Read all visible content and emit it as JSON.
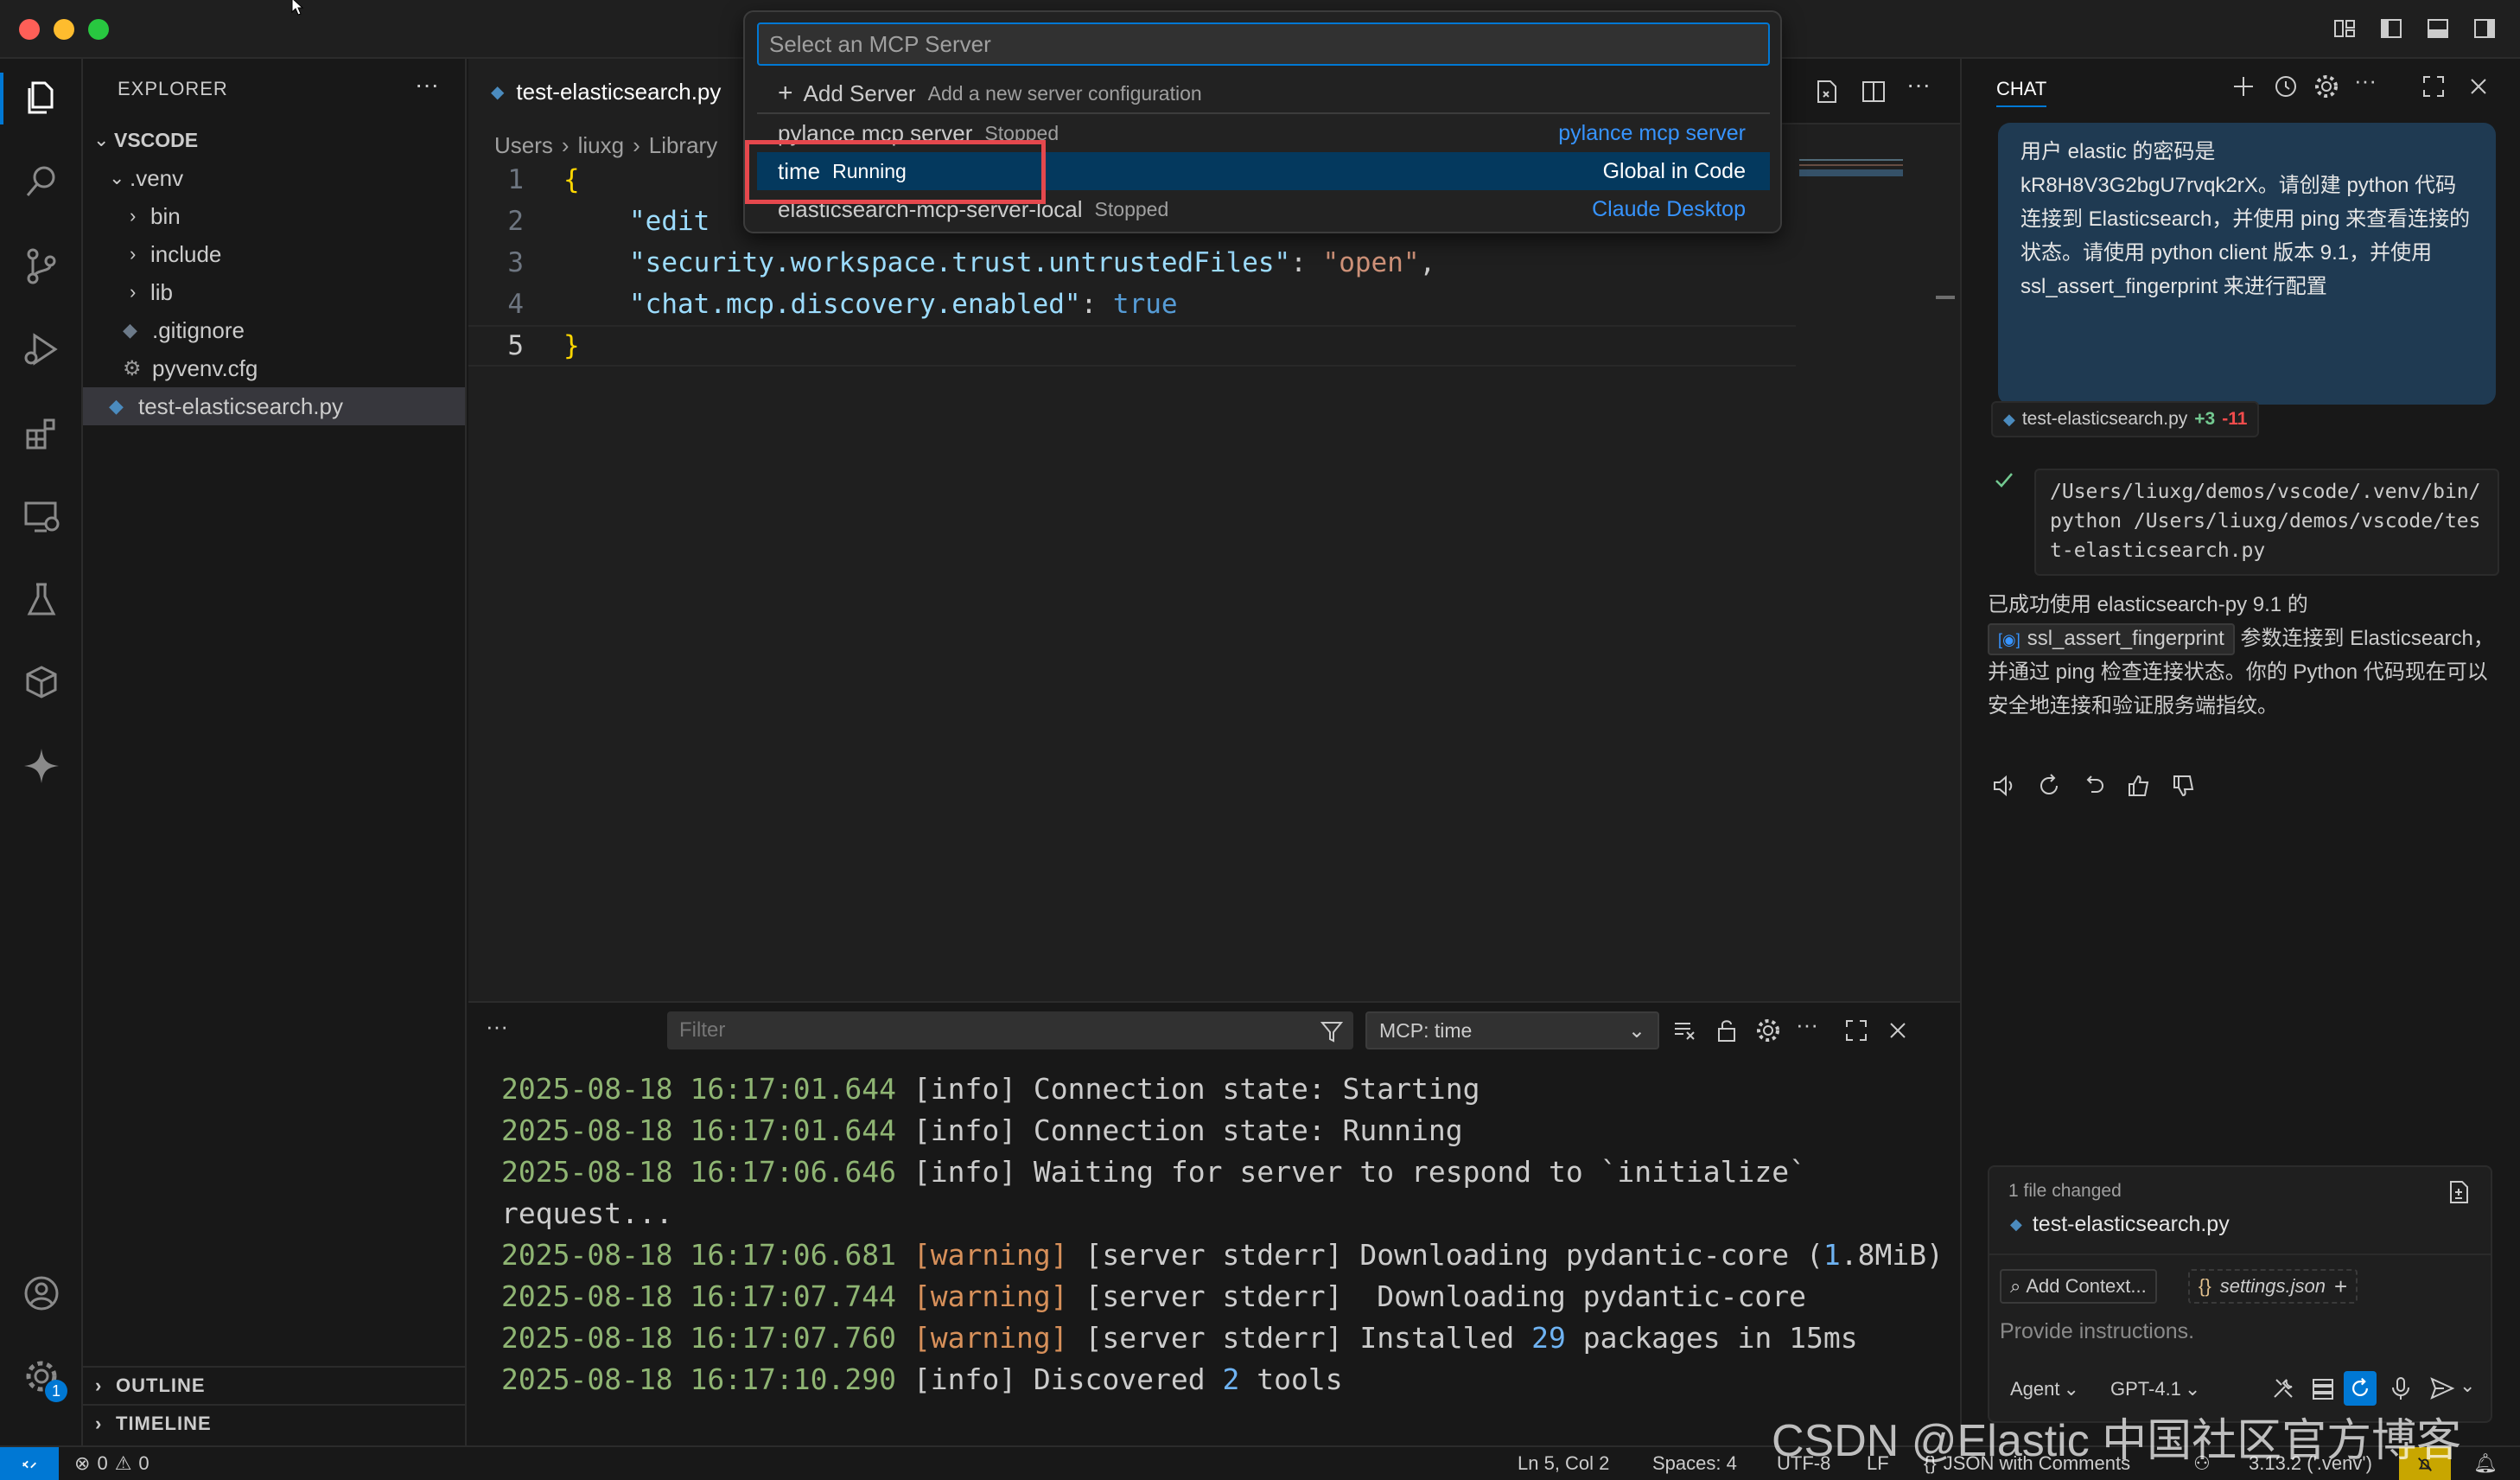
{
  "explorer": {
    "header": "EXPLORER",
    "root": "VSCODE",
    "items": [
      {
        "label": ".venv"
      },
      {
        "label": "bin"
      },
      {
        "label": "include"
      },
      {
        "label": "lib"
      },
      {
        "label": ".gitignore"
      },
      {
        "label": "pyvenv.cfg"
      },
      {
        "label": "test-elasticsearch.py"
      }
    ],
    "outline": "OUTLINE",
    "timeline": "TIMELINE"
  },
  "editor": {
    "tab_label": "test-elasticsearch.py",
    "breadcrumb": [
      "Users",
      "liuxg",
      "Library"
    ],
    "lines": [
      {
        "n": "1",
        "text": "{"
      },
      {
        "n": "2",
        "text": "\"edit"
      },
      {
        "n": "3",
        "key": "\"security.workspace.trust.untrustedFiles\"",
        "sep": ": ",
        "val": "\"open\"",
        "end": ","
      },
      {
        "n": "4",
        "key": "\"chat.mcp.discovery.enabled\"",
        "sep": ": ",
        "val": "true"
      },
      {
        "n": "5",
        "text": "}"
      }
    ]
  },
  "quickpick": {
    "placeholder": "Select an MCP Server",
    "add_label": "Add Server",
    "add_desc": "Add a new server configuration",
    "items": [
      {
        "label": "pylance mcp server",
        "status": "Stopped",
        "source": "pylance mcp server"
      },
      {
        "label": "time",
        "status": "Running",
        "source": "Global in Code"
      },
      {
        "label": "elasticsearch-mcp-server-local",
        "status": "Stopped",
        "source": "Claude Desktop"
      }
    ]
  },
  "panel": {
    "dots": "···",
    "filter_placeholder": "Filter",
    "channel": "MCP: time",
    "logs": [
      {
        "ts": "2025-08-18 16:17:01.644",
        "level": "[info]",
        "msg": " Connection state: Starting"
      },
      {
        "ts": "2025-08-18 16:17:01.644",
        "level": "[info]",
        "msg": " Connection state: Running"
      },
      {
        "ts": "2025-08-18 16:17:06.646",
        "level": "[info]",
        "msg": " Waiting for server to respond to `initialize`"
      },
      {
        "ts": "",
        "level": "",
        "msg": "request..."
      },
      {
        "ts": "2025-08-18 16:17:06.681",
        "level": "[warning]",
        "msg": " [server stderr] Downloading pydantic-core (",
        "num": "1",
        "tail": ".8MiB)"
      },
      {
        "ts": "2025-08-18 16:17:07.744",
        "level": "[warning]",
        "msg": " [server stderr]  Downloading pydantic-core"
      },
      {
        "ts": "2025-08-18 16:17:07.760",
        "level": "[warning]",
        "msg": " [server stderr] Installed ",
        "num": "29",
        "tail": " packages in 15ms"
      },
      {
        "ts": "2025-08-18 16:17:10.290",
        "level": "[info]",
        "msg": " Discovered ",
        "num": "2",
        "tail": " tools"
      }
    ]
  },
  "chat": {
    "title": "CHAT",
    "user_message": "用户 elastic 的密码是 kR8H8V3G2bgU7rvqk2rX。请创建 python 代码连接到 Elasticsearch，并使用 ping 来查看连接的状态。请使用 python client 版本 9.1，并使用 ssl_assert_fingerprint 来进行配置",
    "file_chip": {
      "name": "test-elasticsearch.py",
      "added": "+3",
      "removed": "-11"
    },
    "command": "/Users/liuxg/demos/vscode/.venv/bin/python /Users/liuxg/demos/vscode/test-elasticsearch.py",
    "reply_pre": "已成功使用 elasticsearch-py 9.1 的",
    "reply_code": "ssl_assert_fingerprint",
    "reply_post": "参数连接到 Elasticsearch，并通过 ping 检查连接状态。你的 Python 代码现在可以安全地连接和验证服务端指纹。",
    "changed_label": "1 file changed",
    "changed_file": "test-elasticsearch.py",
    "add_context": "Add Context...",
    "settings_chip": "settings.json",
    "input_placeholder": "Provide instructions.",
    "mode": "Agent",
    "model": "GPT-4.1"
  },
  "statusbar": {
    "errors": "0",
    "warnings": "0",
    "position": "Ln 5, Col 2",
    "spaces": "Spaces: 4",
    "encoding": "UTF-8",
    "eol": "LF",
    "language": "JSON with Comments",
    "python": "3.13.2 ('.venv')"
  },
  "watermark": "CSDN @Elastic 中国社区官方博客",
  "colors": {
    "accent": "#0078d4",
    "highlight_box": "#e5484d",
    "selection": "#04395e"
  }
}
